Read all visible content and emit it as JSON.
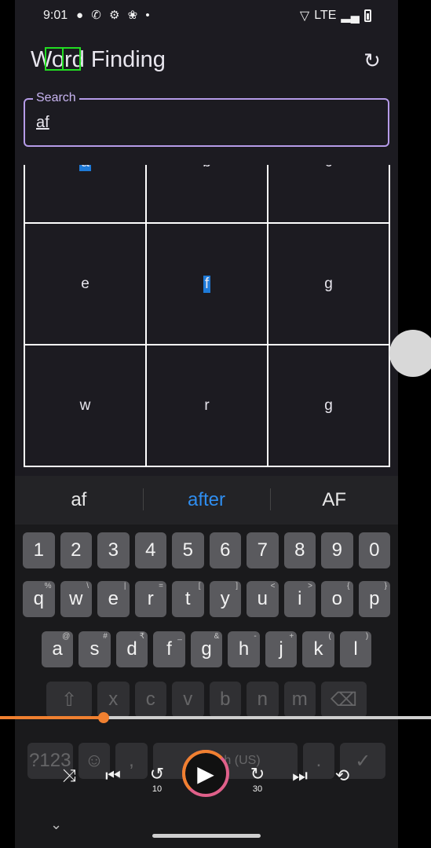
{
  "status": {
    "time": "9:01",
    "left_icons": "● ✆ ⚙ ❀ •",
    "network": "LTE"
  },
  "app": {
    "title": "Word Finding"
  },
  "search": {
    "label": "Search",
    "value": "af"
  },
  "grid": {
    "cells": [
      "a",
      "b",
      "c",
      "e",
      "f",
      "g",
      "w",
      "r",
      "g"
    ],
    "selected": [
      "a",
      "f"
    ]
  },
  "keyboard": {
    "suggestions": [
      "af",
      "after",
      "AF"
    ],
    "number_row": [
      "1",
      "2",
      "3",
      "4",
      "5",
      "6",
      "7",
      "8",
      "9",
      "0"
    ],
    "row_q": [
      {
        "k": "q",
        "h": "%"
      },
      {
        "k": "w",
        "h": "\\"
      },
      {
        "k": "e",
        "h": "|"
      },
      {
        "k": "r",
        "h": "="
      },
      {
        "k": "t",
        "h": "["
      },
      {
        "k": "y",
        "h": "]"
      },
      {
        "k": "u",
        "h": "<"
      },
      {
        "k": "i",
        "h": ">"
      },
      {
        "k": "o",
        "h": "{"
      },
      {
        "k": "p",
        "h": "}"
      }
    ],
    "row_a": [
      {
        "k": "a",
        "h": "@"
      },
      {
        "k": "s",
        "h": "#"
      },
      {
        "k": "d",
        "h": "₹"
      },
      {
        "k": "f",
        "h": "_"
      },
      {
        "k": "g",
        "h": "&"
      },
      {
        "k": "h",
        "h": "-"
      },
      {
        "k": "j",
        "h": "+"
      },
      {
        "k": "k",
        "h": "("
      },
      {
        "k": "l",
        "h": ")"
      }
    ],
    "row_z": [
      "x",
      "c",
      "v",
      "b",
      "n",
      "m"
    ],
    "bottom": {
      "symbols": "?123",
      "comma": ",",
      "space": "English (US)",
      "period": "."
    }
  },
  "player": {
    "progress_percent": 24,
    "rewind_seconds": "10",
    "forward_seconds": "30"
  }
}
